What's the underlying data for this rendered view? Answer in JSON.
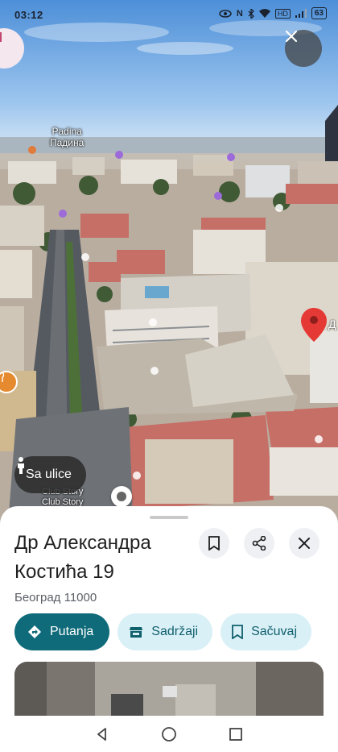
{
  "status_bar": {
    "time": "03:12",
    "network": "N",
    "hd": "HD",
    "battery": "63"
  },
  "map": {
    "district_label": "Padina",
    "district_label_cyrillic": "Падина",
    "venue_label": "Club Story",
    "venue_label_secondary": "Club Story",
    "pin_label_fragment": "Д"
  },
  "street_view_button": {
    "label": "Sa ulice"
  },
  "place": {
    "title_line1": "Др Александра",
    "title_line2": "Костића 19",
    "subtitle": "Београд 11000"
  },
  "actions": [
    {
      "label": "Putanja",
      "icon": "directions-icon"
    },
    {
      "label": "Sadržaji",
      "icon": "store-icon"
    },
    {
      "label": "Sačuvaj",
      "icon": "bookmark-icon"
    }
  ],
  "colors": {
    "primary": "#0f6b7a",
    "secondary_bg": "#d9f0f6",
    "pin": "#e53935"
  }
}
